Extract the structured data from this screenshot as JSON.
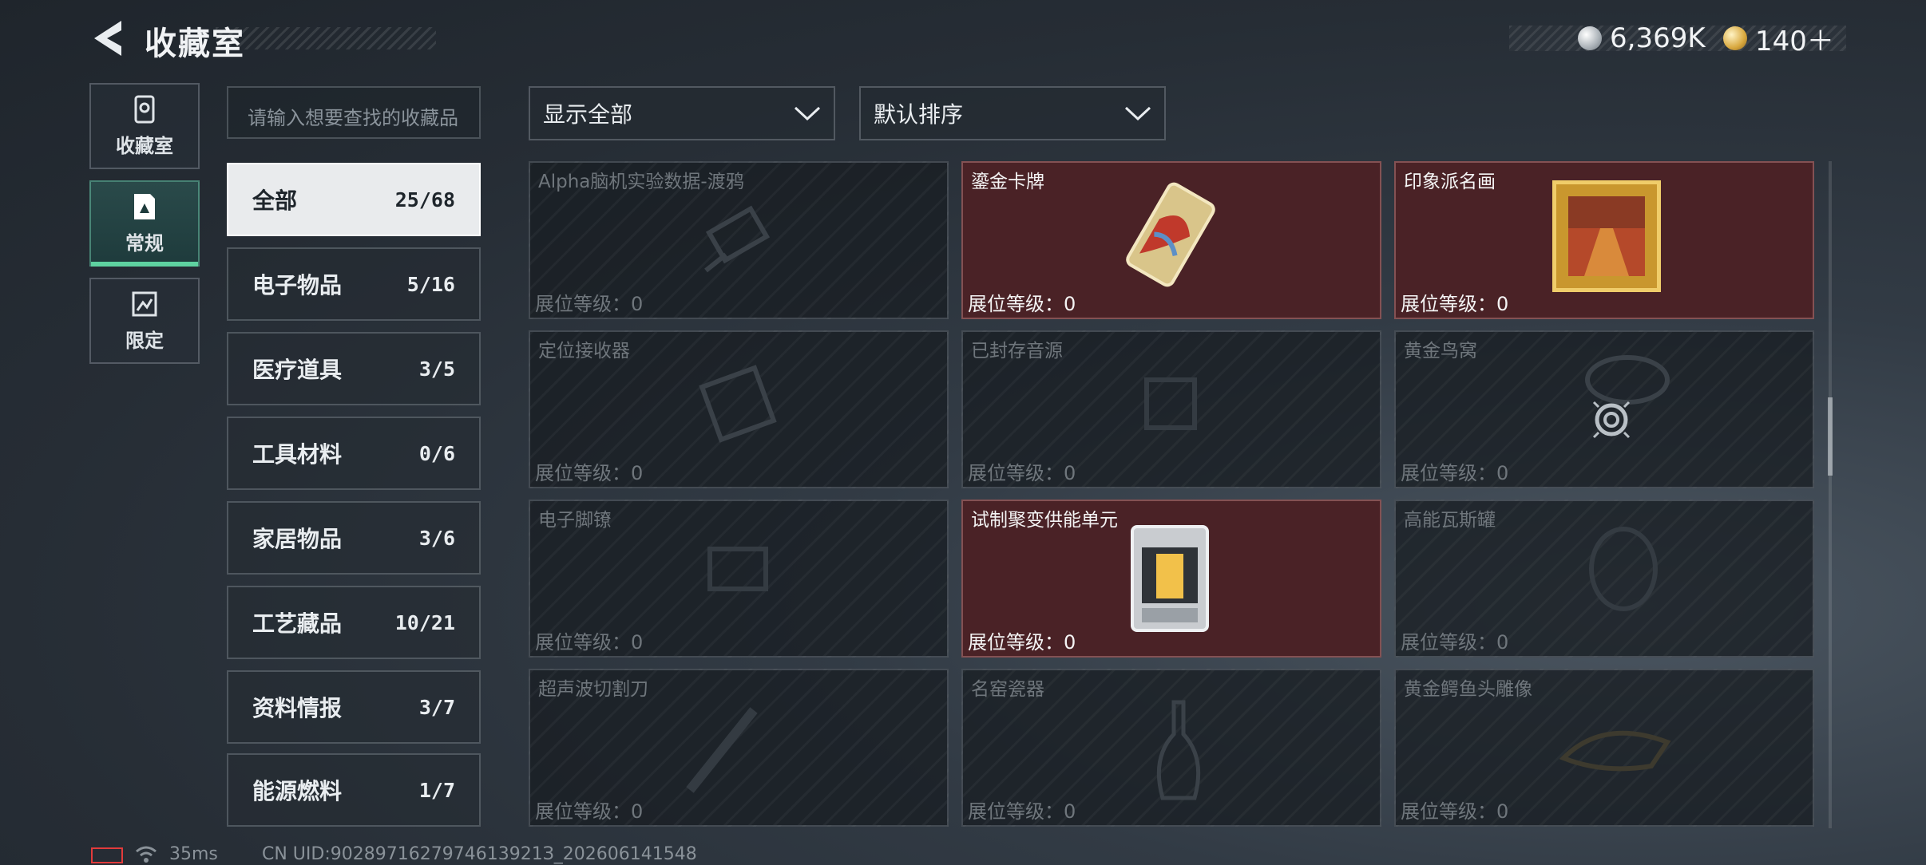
{
  "header": {
    "title": "收藏室",
    "currencies": [
      {
        "icon": "silver-coin-icon",
        "value": "6,369K"
      },
      {
        "icon": "gold-coin-icon",
        "value": "140＋"
      }
    ]
  },
  "mode_tabs": [
    {
      "label": "收藏室",
      "icon": "collection-room-icon",
      "active": false
    },
    {
      "label": "常规",
      "icon": "regular-display-icon",
      "active": true
    },
    {
      "label": "限定",
      "icon": "limited-display-icon",
      "active": false
    }
  ],
  "search": {
    "placeholder": "请输入想要查找的收藏品"
  },
  "categories": [
    {
      "name": "全部",
      "count": "25/68",
      "active": true
    },
    {
      "name": "电子物品",
      "count": "5/16"
    },
    {
      "name": "医疗道具",
      "count": "3/5"
    },
    {
      "name": "工具材料",
      "count": "0/6"
    },
    {
      "name": "家居物品",
      "count": "3/6"
    },
    {
      "name": "工艺藏品",
      "count": "10/21"
    },
    {
      "name": "资料情报",
      "count": "3/7"
    },
    {
      "name": "能源燃料",
      "count": "1/7"
    }
  ],
  "filters": {
    "show": "显示全部",
    "sort": "默认排序"
  },
  "items": [
    {
      "name": "Alpha脑机实验数据-渡鸦",
      "level": "展位等级：0",
      "owned": false,
      "icon": "data-drive-icon"
    },
    {
      "name": "鎏金卡牌",
      "level": "展位等级：0",
      "owned": true,
      "icon": "gilded-card-icon"
    },
    {
      "name": "印象派名画",
      "level": "展位等级：0",
      "owned": true,
      "icon": "framed-painting-icon"
    },
    {
      "name": "定位接收器",
      "level": "展位等级：0",
      "owned": false,
      "icon": "locator-receiver-icon"
    },
    {
      "name": "已封存音源",
      "level": "展位等级：0",
      "owned": false,
      "icon": "sealed-audio-icon"
    },
    {
      "name": "黄金鸟窝",
      "level": "展位等级：0",
      "owned": false,
      "icon": "golden-nest-icon"
    },
    {
      "name": "电子脚镣",
      "level": "展位等级：0",
      "owned": false,
      "icon": "ankle-monitor-icon"
    },
    {
      "name": "试制聚变供能单元",
      "level": "展位等级：0",
      "owned": true,
      "icon": "fusion-cell-icon"
    },
    {
      "name": "高能瓦斯罐",
      "level": "展位等级：0",
      "owned": false,
      "icon": "gas-canister-icon"
    },
    {
      "name": "超声波切割刀",
      "level": "展位等级：0",
      "owned": false,
      "icon": "ultrasonic-cutter-icon"
    },
    {
      "name": "名窑瓷器",
      "level": "展位等级：0",
      "owned": false,
      "icon": "porcelain-vase-icon"
    },
    {
      "name": "黄金鳄鱼头雕像",
      "level": "展位等级：0",
      "owned": false,
      "icon": "golden-crocodile-icon"
    }
  ],
  "status_bar": {
    "ping": "35ms",
    "uid": "CN UID:9028971627974613921З_202606141548"
  }
}
